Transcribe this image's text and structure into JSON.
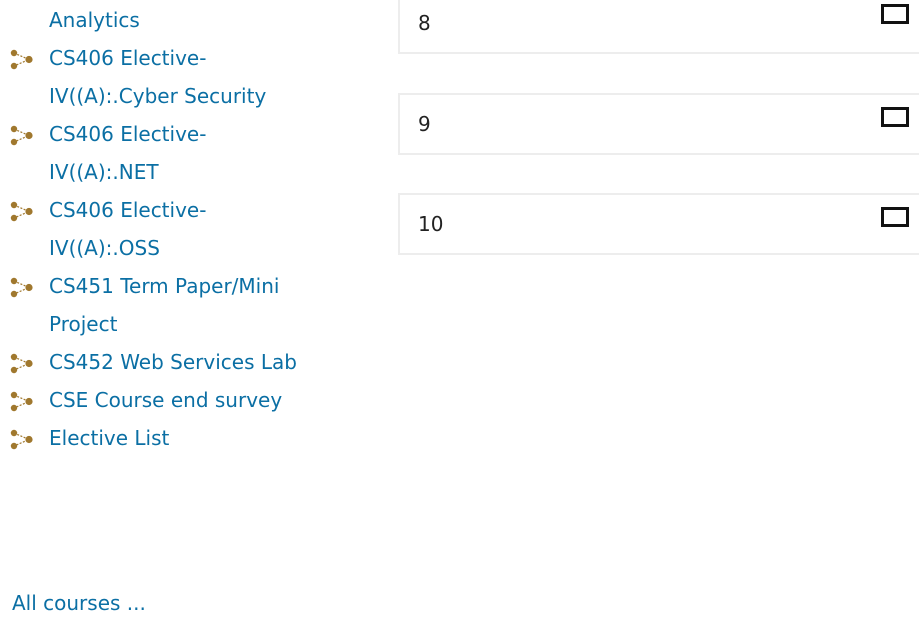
{
  "sidebar": {
    "courses": [
      {
        "label": "Analytics",
        "continuation": true
      },
      {
        "label": "CS406 Elective-IV((A):.Cyber Security"
      },
      {
        "label": "CS406 Elective-IV((A):.NET"
      },
      {
        "label": "CS406 Elective-IV((A):.OSS"
      },
      {
        "label": "CS451 Term Paper/Mini Project"
      },
      {
        "label": "CS452 Web Services Lab"
      },
      {
        "label": "CSE Course end survey"
      },
      {
        "label": "Elective List"
      }
    ],
    "all_courses": "All courses ..."
  },
  "answers": [
    {
      "label": "8"
    },
    {
      "label": "9"
    },
    {
      "label": "10"
    }
  ],
  "colors": {
    "link": "#0b6fa4",
    "icon_dot": "#a0782e"
  },
  "icon_name": "course-icon"
}
